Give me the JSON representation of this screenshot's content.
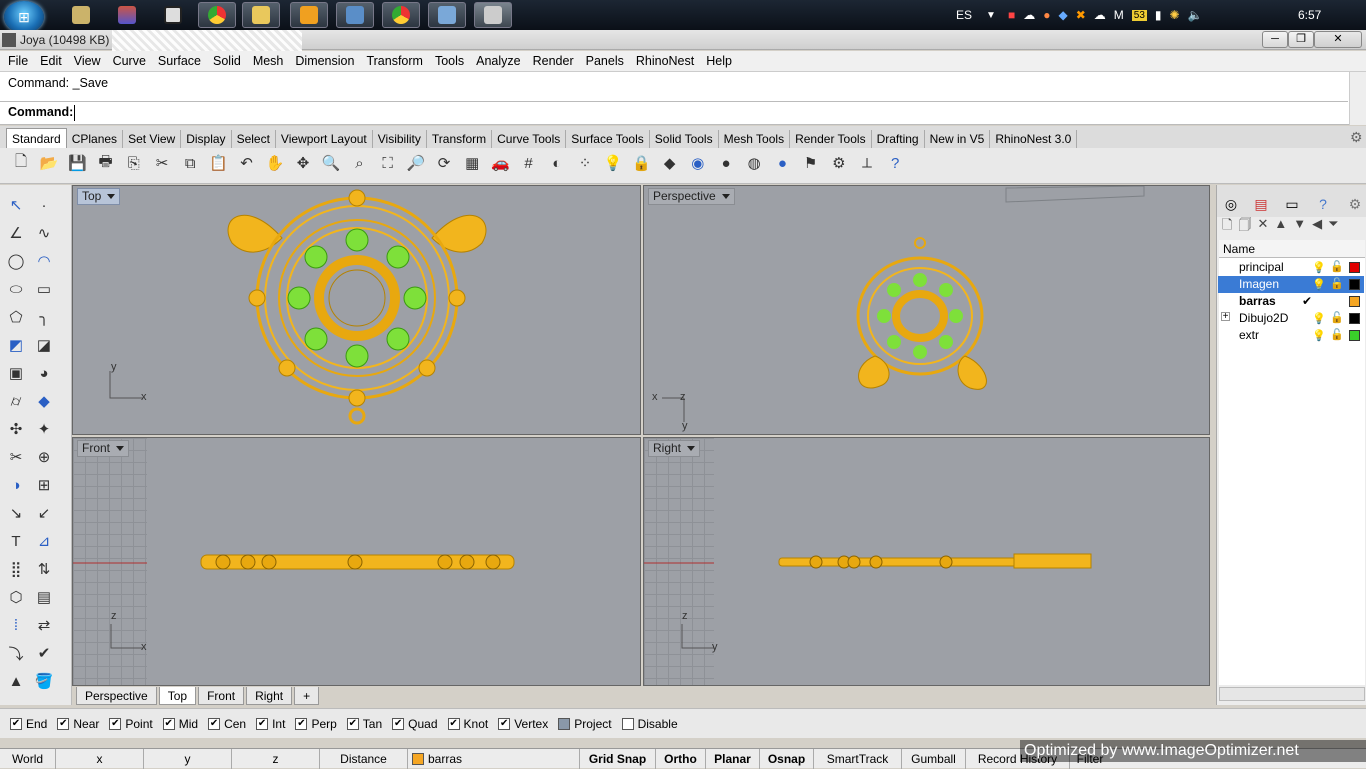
{
  "taskbar": {
    "language": "ES",
    "badge": "53",
    "tray_m": "M",
    "clock": "6:57"
  },
  "titlebar": {
    "title": "Joya (10498 KB) - "
  },
  "menu": [
    "File",
    "Edit",
    "View",
    "Curve",
    "Surface",
    "Solid",
    "Mesh",
    "Dimension",
    "Transform",
    "Tools",
    "Analyze",
    "Render",
    "Panels",
    "RhinoNest",
    "Help"
  ],
  "command": {
    "history": "Command: _Save",
    "prompt": "Command:"
  },
  "toolbar_tabs": [
    "Standard",
    "CPlanes",
    "Set View",
    "Display",
    "Select",
    "Viewport Layout",
    "Visibility",
    "Transform",
    "Curve Tools",
    "Surface Tools",
    "Solid Tools",
    "Mesh Tools",
    "Render Tools",
    "Drafting",
    "New in V5",
    "RhinoNest 3.0"
  ],
  "viewports": {
    "top": {
      "label": "Top",
      "axis_y": "y",
      "axis_x": "x"
    },
    "perspective": {
      "label": "Perspective",
      "axis_x": "x",
      "axis_z": "z",
      "axis_y": "y"
    },
    "front": {
      "label": "Front",
      "axis_z": "z",
      "axis_x": "x"
    },
    "right": {
      "label": "Right",
      "axis_z": "z",
      "axis_y": "y"
    }
  },
  "viewport_tabs": [
    "Perspective",
    "Top",
    "Front",
    "Right"
  ],
  "layers": {
    "header": "Name",
    "items": [
      {
        "name": "principal",
        "color": "#e00000"
      },
      {
        "name": "Imagen",
        "color": "#000000"
      },
      {
        "name": "barras",
        "color": "#f5a623",
        "current": "✔"
      },
      {
        "name": "Dibujo2D",
        "color": "#000000"
      },
      {
        "name": "extr",
        "color": "#3ad12a"
      }
    ]
  },
  "osnaps": [
    {
      "label": "End",
      "checked": true
    },
    {
      "label": "Near",
      "checked": true
    },
    {
      "label": "Point",
      "checked": true
    },
    {
      "label": "Mid",
      "checked": true
    },
    {
      "label": "Cen",
      "checked": true
    },
    {
      "label": "Int",
      "checked": true
    },
    {
      "label": "Perp",
      "checked": true
    },
    {
      "label": "Tan",
      "checked": true
    },
    {
      "label": "Quad",
      "checked": true
    },
    {
      "label": "Knot",
      "checked": true
    },
    {
      "label": "Vertex",
      "checked": true
    },
    {
      "label": "Project",
      "checked": false
    },
    {
      "label": "Disable",
      "checked": false
    }
  ],
  "status": {
    "cplane": "World",
    "x": "x",
    "y": "y",
    "z": "z",
    "distance": "Distance",
    "layer": "barras",
    "layer_color": "#f5a623",
    "grid_snap": "Grid Snap",
    "ortho": "Ortho",
    "planar": "Planar",
    "osnap": "Osnap",
    "smarttrack": "SmartTrack",
    "gumball": "Gumball",
    "record_history": "Record History",
    "filter": "Filter"
  },
  "watermark": "Optimized by www.ImageOptimizer.net",
  "colors": {
    "gold": "#f2b51d",
    "gold_dark": "#b58200",
    "green": "#7ee03a",
    "viewport_bg": "#9da0a6"
  }
}
